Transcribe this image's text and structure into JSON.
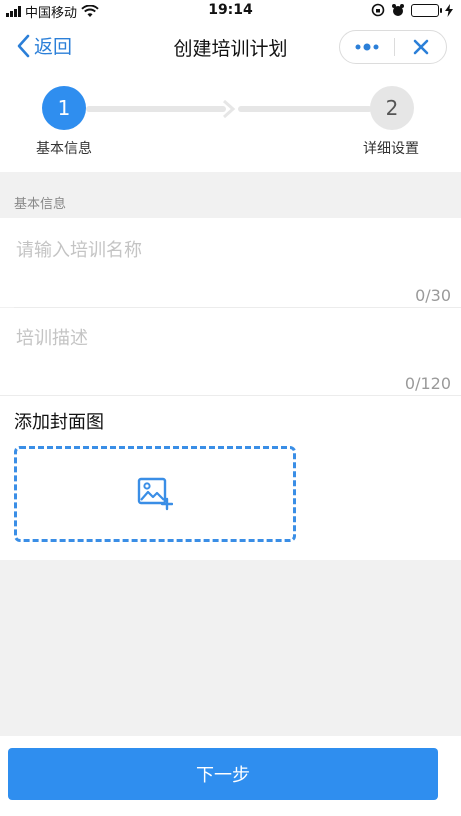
{
  "status_bar": {
    "carrier": "中国移动",
    "time": "19:14"
  },
  "nav": {
    "back_label": "返回",
    "title": "创建培训计划"
  },
  "stepper": {
    "steps": [
      {
        "number": "1",
        "label": "基本信息",
        "active": true
      },
      {
        "number": "2",
        "label": "详细设置",
        "active": false
      }
    ]
  },
  "form": {
    "section_title": "基本信息",
    "name_placeholder": "请输入培训名称",
    "name_counter": "0/30",
    "desc_placeholder": "培训描述",
    "desc_counter": "0/120",
    "cover_label": "添加封面图"
  },
  "footer": {
    "next_label": "下一步"
  },
  "colors": {
    "accent": "#2f8eef",
    "inactive_step": "#e6e6e6"
  }
}
